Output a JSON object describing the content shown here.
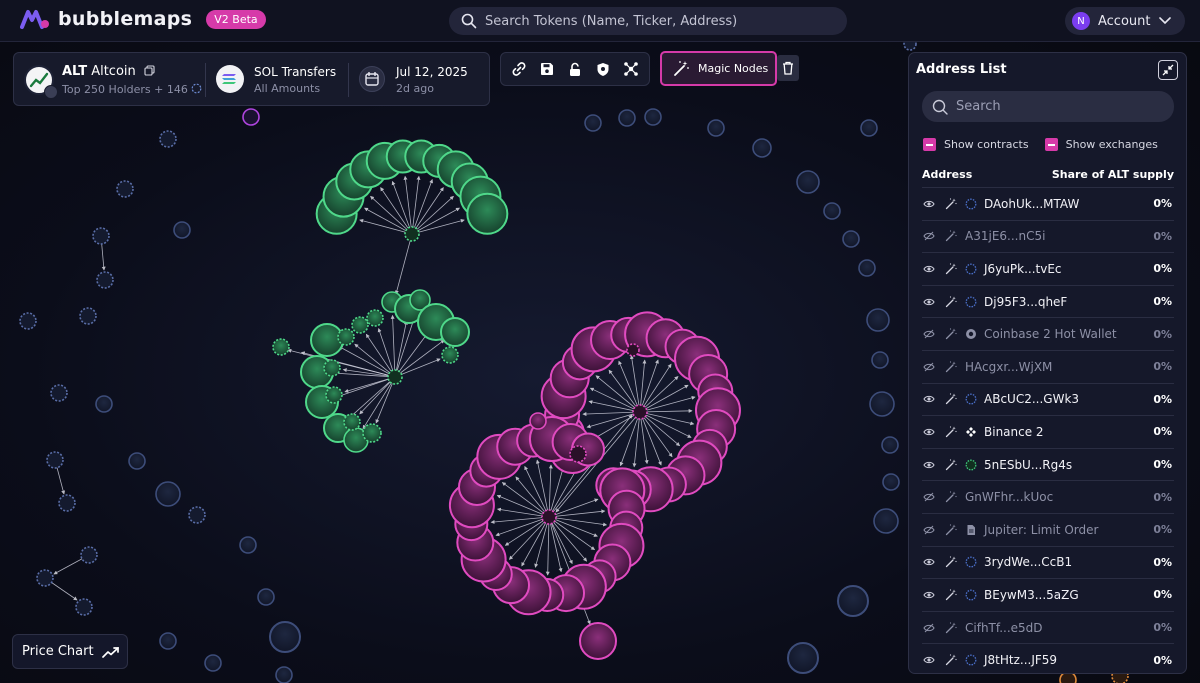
{
  "app": {
    "name": "bubblemaps",
    "badge": "V2 Beta"
  },
  "search": {
    "placeholder": "Search Tokens (Name, Ticker, Address)"
  },
  "account": {
    "initial": "N",
    "label": "Account"
  },
  "token": {
    "ticker": "ALT",
    "name": "Altcoin",
    "holders_label": "Top 250 Holders + 146",
    "transfers_title": "SOL Transfers",
    "transfers_sub": "All Amounts",
    "date": "Jul 12, 2025",
    "date_ago": "2d ago"
  },
  "toolbar": {
    "icons": [
      "link-icon",
      "save-icon",
      "lock-icon",
      "shield-icon",
      "network-icon"
    ],
    "magic_label": "Magic Nodes"
  },
  "price_chart": {
    "label": "Price Chart"
  },
  "address_list": {
    "title": "Address List",
    "search_placeholder": "Search",
    "filters": [
      "Show contracts",
      "Show exchanges"
    ],
    "col_address": "Address",
    "col_share": "Share of ALT supply",
    "rows": [
      {
        "name": "DAohUk...MTAW",
        "share": "0%",
        "visible": true,
        "marker": "ring"
      },
      {
        "name": "A31jE6...nC5i",
        "share": "0%",
        "visible": false,
        "marker": "none"
      },
      {
        "name": "J6yuPk...tvEc",
        "share": "0%",
        "visible": true,
        "marker": "ring"
      },
      {
        "name": "Dj95F3...qheF",
        "share": "0%",
        "visible": true,
        "marker": "ring"
      },
      {
        "name": "Coinbase 2 Hot Wallet",
        "share": "0%",
        "visible": false,
        "marker": "coinbase"
      },
      {
        "name": "HAcgxr...WjXM",
        "share": "0%",
        "visible": false,
        "marker": "none"
      },
      {
        "name": "ABcUC2...GWk3",
        "share": "0%",
        "visible": true,
        "marker": "ring"
      },
      {
        "name": "Binance 2",
        "share": "0%",
        "visible": true,
        "marker": "binance"
      },
      {
        "name": "5nESbU...Rg4s",
        "share": "0%",
        "visible": true,
        "marker": "green-ring"
      },
      {
        "name": "GnWFhr...kUoc",
        "share": "0%",
        "visible": false,
        "marker": "none"
      },
      {
        "name": "Jupiter: Limit Order",
        "share": "0%",
        "visible": false,
        "marker": "doc"
      },
      {
        "name": "3rydWe...CcB1",
        "share": "0%",
        "visible": true,
        "marker": "ring"
      },
      {
        "name": "BEywM3...5aZG",
        "share": "0%",
        "visible": true,
        "marker": "ring"
      },
      {
        "name": "CifhTf...e5dD",
        "share": "0%",
        "visible": false,
        "marker": "none"
      },
      {
        "name": "J8tHtz...JF59",
        "share": "0%",
        "visible": true,
        "marker": "ring"
      }
    ]
  },
  "colors": {
    "accent": "#d63aa9",
    "green_cluster": "#3ec77a",
    "magenta_cluster": "#d63aa9",
    "lone_bubble": "#3b4a72"
  }
}
